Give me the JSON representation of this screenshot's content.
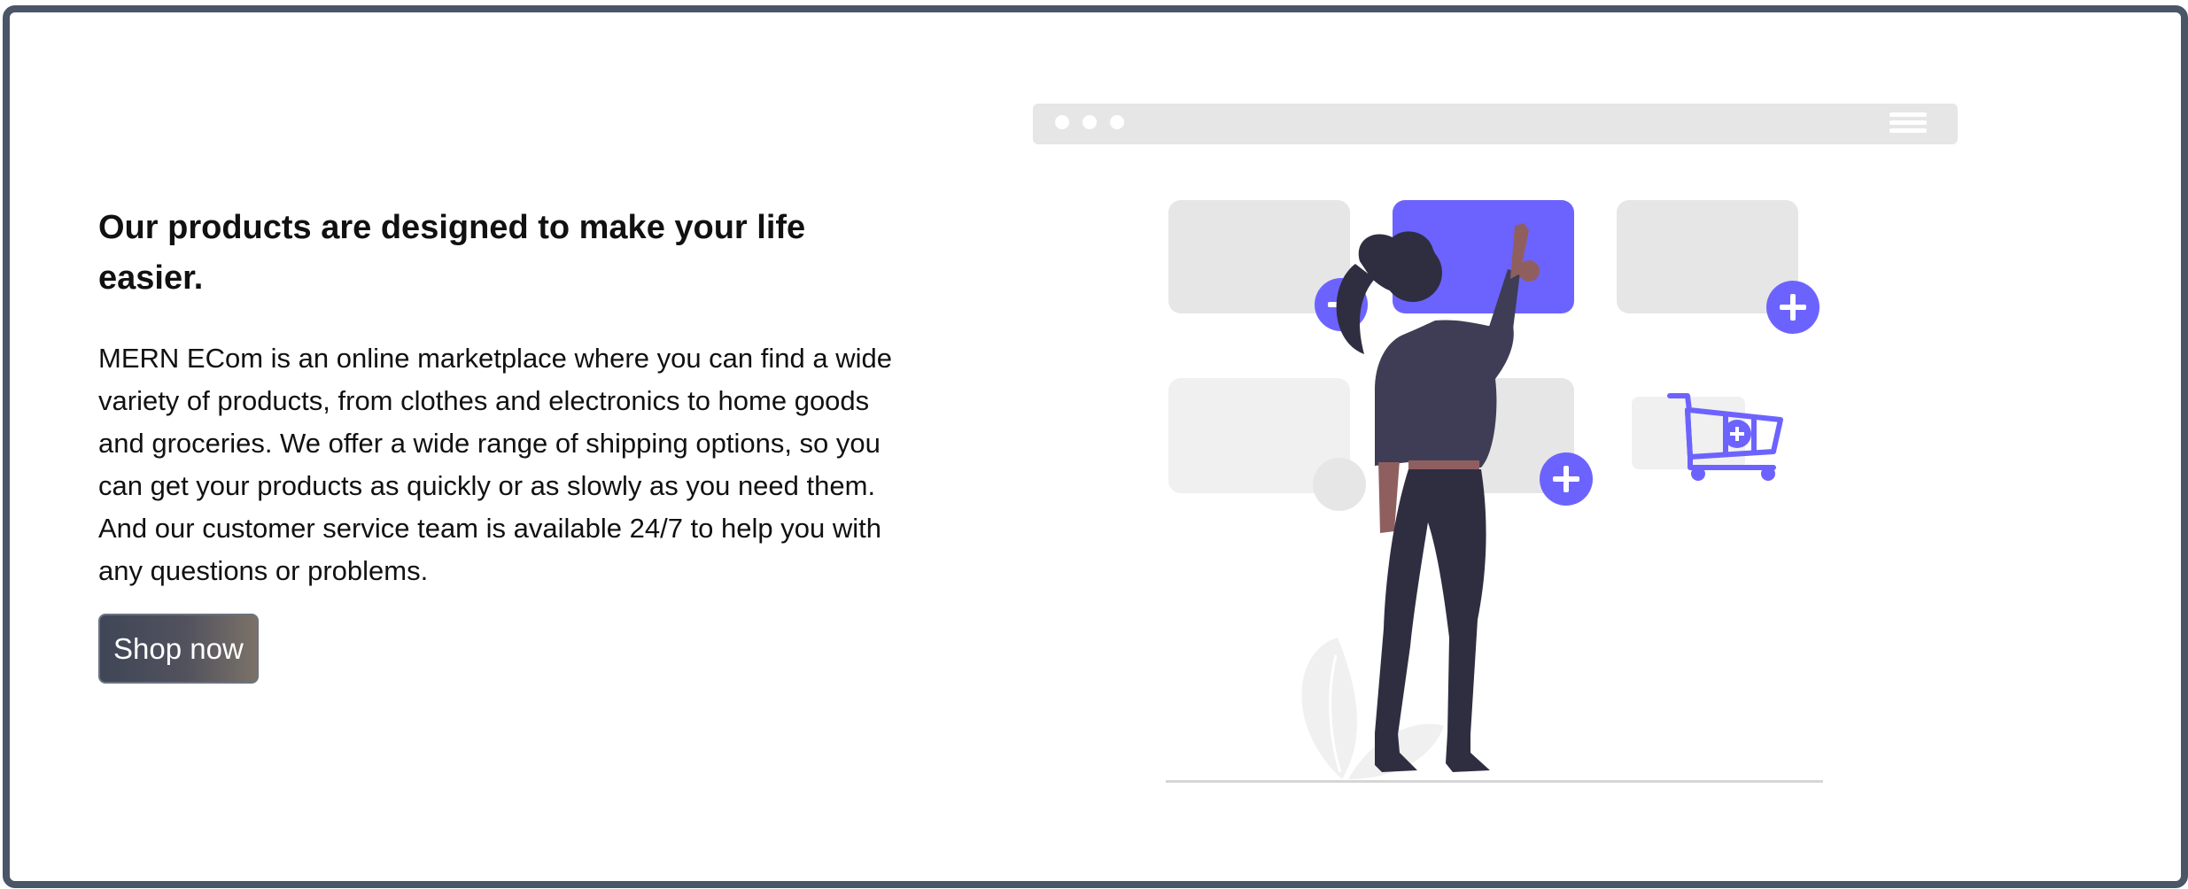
{
  "hero": {
    "headline": "Our products are designed to make your life easier.",
    "description": "MERN ECom is an online marketplace where you can find a wide variety of products, from clothes and electronics to home goods and groceries. We offer a wide range of shipping options, so you can get your products as quickly or as slowly as you need them. And our customer service team is available 24/7 to help you with any questions or problems.",
    "cta_label": "Shop now"
  },
  "illustration": {
    "subject": "woman-adding-products-to-cart",
    "colors": {
      "accent": "#6c63ff",
      "card": "#e6e6e6",
      "card_light": "#f0f0f0",
      "skin": "#8f5f5f",
      "hair": "#2f2e41",
      "jacket": "#3f3d56",
      "pants": "#2f2e41",
      "ground": "#d6d6d6"
    }
  },
  "theme": {
    "border": "#4a5568",
    "text": "#111111",
    "button_text": "#ffffff"
  }
}
